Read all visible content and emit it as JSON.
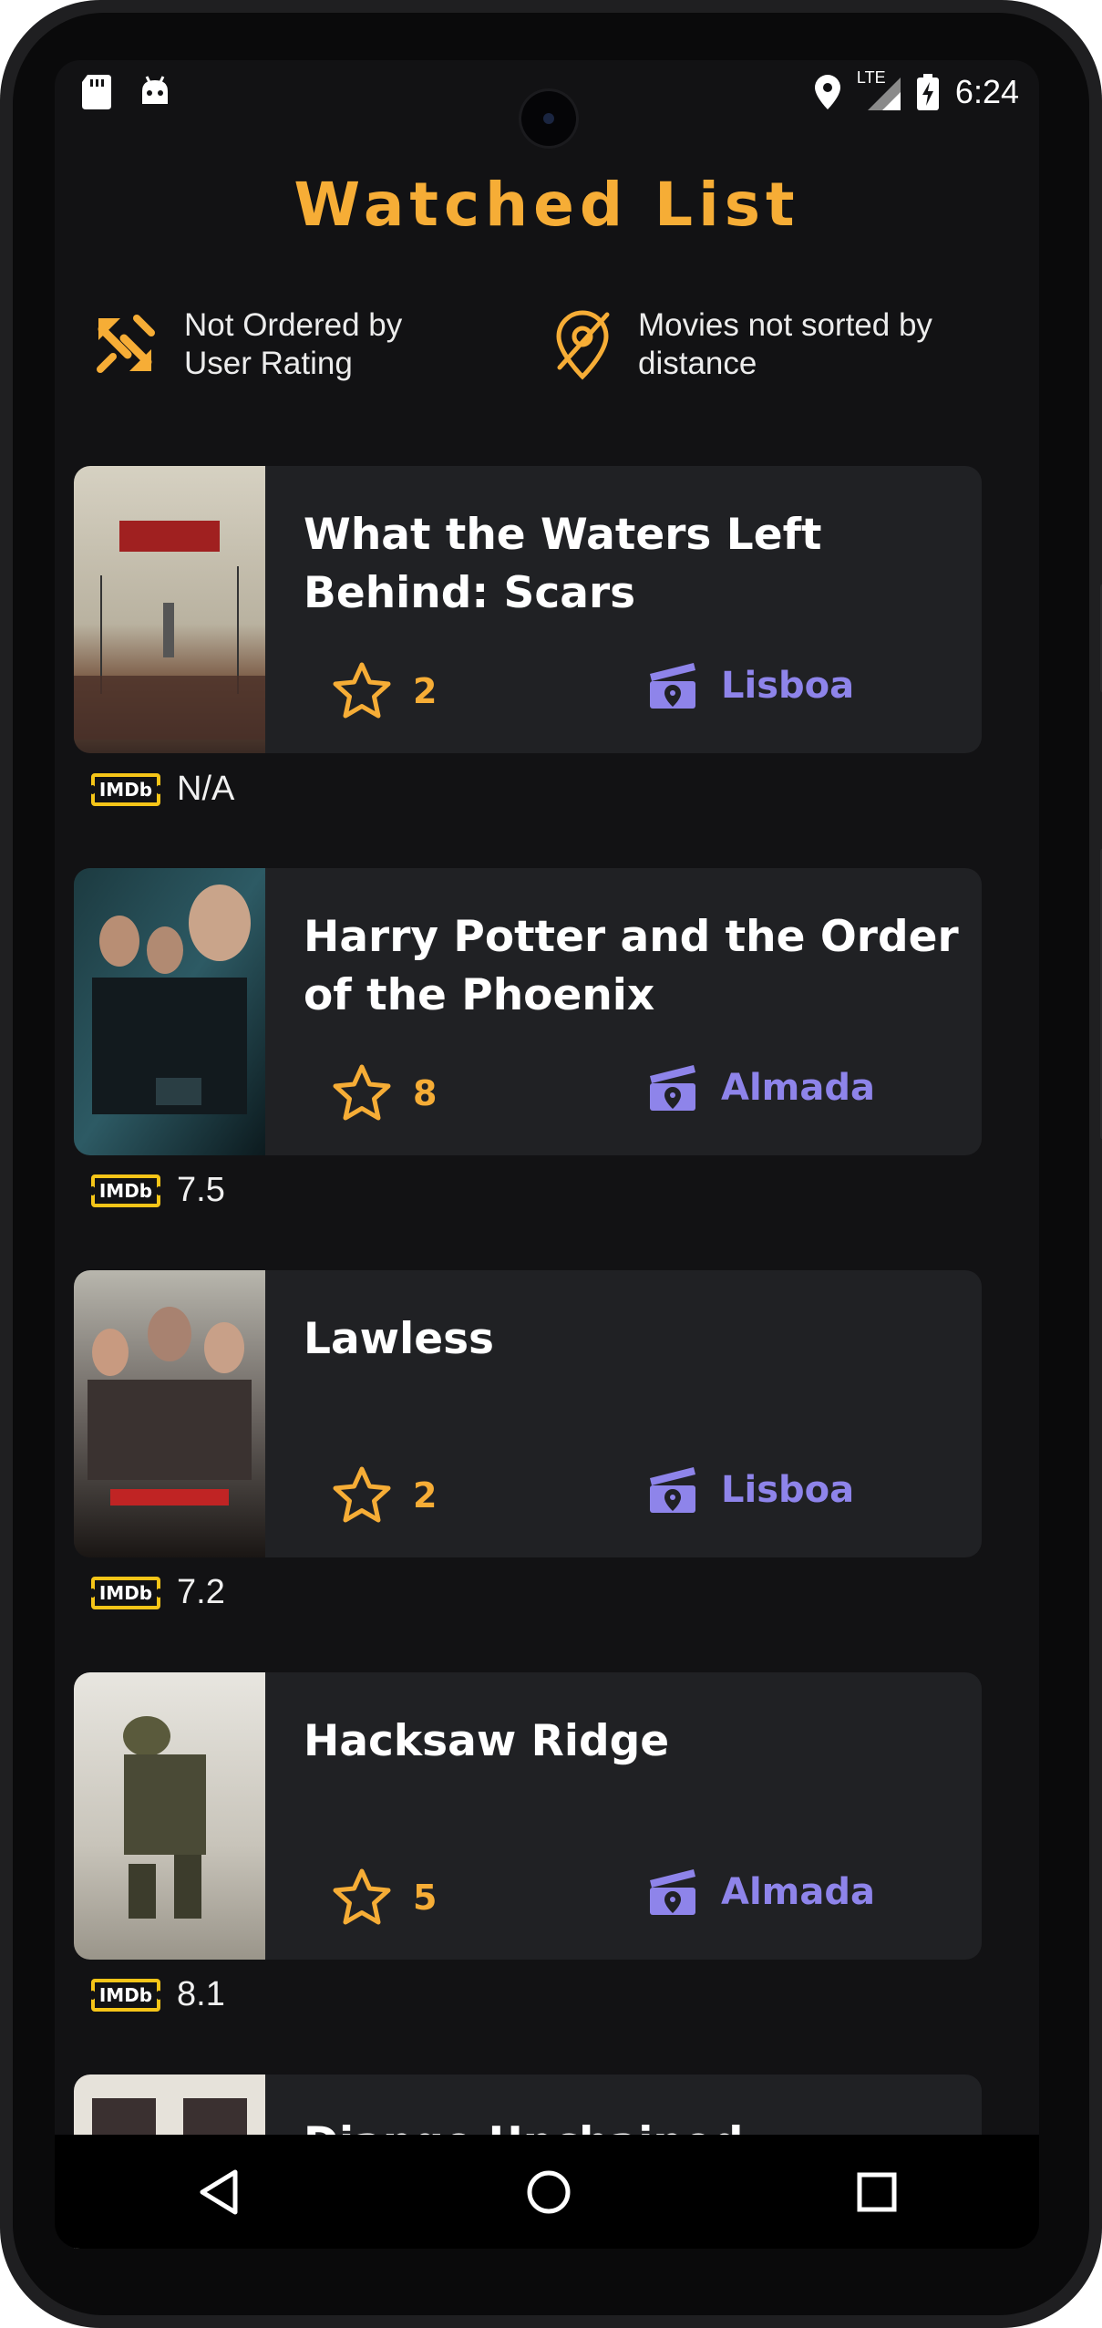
{
  "status_bar": {
    "time": "6:24",
    "network": "LTE",
    "icons_left": [
      "sd-card-icon",
      "android-icon"
    ],
    "icons_right": [
      "location-pin-icon",
      "signal-icon",
      "battery-charging-icon"
    ]
  },
  "header": {
    "title": "Watched List"
  },
  "filters": {
    "rating_sort": {
      "label": "Not Ordered by User Rating",
      "icon": "sort-arrows-icon"
    },
    "distance_sort": {
      "label": "Movies not sorted by distance",
      "icon": "location-off-icon"
    }
  },
  "movies": [
    {
      "title": "What the Waters Left Behind: Scars",
      "user_rating": "2",
      "location": "Lisboa",
      "imdb_label": "IMDb",
      "imdb_rating": "N/A"
    },
    {
      "title": "Harry Potter and the Order of the Phoenix",
      "user_rating": "8",
      "location": "Almada",
      "imdb_label": "IMDb",
      "imdb_rating": "7.5"
    },
    {
      "title": "Lawless",
      "user_rating": "2",
      "location": "Lisboa",
      "imdb_label": "IMDb",
      "imdb_rating": "7.2"
    },
    {
      "title": "Hacksaw Ridge",
      "user_rating": "5",
      "location": "Almada",
      "imdb_label": "IMDb",
      "imdb_rating": "8.1"
    },
    {
      "title": "Django Unchained"
    }
  ],
  "nav": {
    "back": "back-triangle-icon",
    "home": "home-circle-icon",
    "recents": "recents-square-icon"
  },
  "colors": {
    "accent": "#f6ad36",
    "location": "#8e84ea",
    "card": "#202124",
    "background": "#121214",
    "imdb": "#f5c518"
  }
}
